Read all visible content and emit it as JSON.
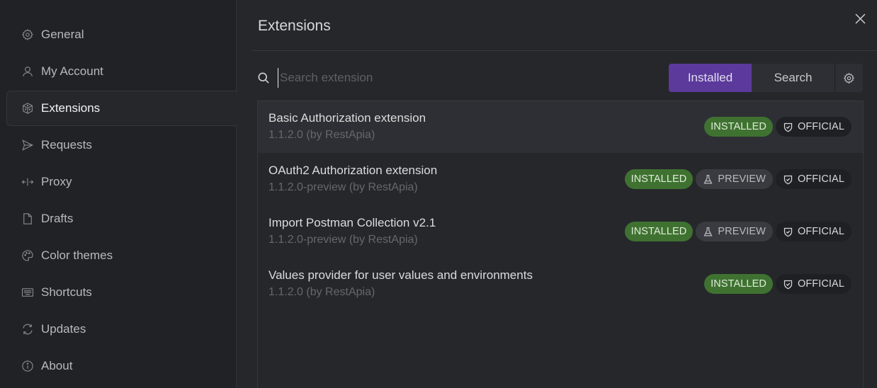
{
  "sidebar": {
    "items": [
      {
        "label": "General",
        "icon": "gear-icon",
        "active": false
      },
      {
        "label": "My Account",
        "icon": "user-icon",
        "active": false
      },
      {
        "label": "Extensions",
        "icon": "cube-icon",
        "active": true
      },
      {
        "label": "Requests",
        "icon": "send-icon",
        "active": false
      },
      {
        "label": "Proxy",
        "icon": "proxy-arrows-icon",
        "active": false
      },
      {
        "label": "Drafts",
        "icon": "file-icon",
        "active": false
      },
      {
        "label": "Color themes",
        "icon": "palette-icon",
        "active": false
      },
      {
        "label": "Shortcuts",
        "icon": "keyboard-icon",
        "active": false
      },
      {
        "label": "Updates",
        "icon": "refresh-icon",
        "active": false
      },
      {
        "label": "About",
        "icon": "info-icon",
        "active": false
      }
    ]
  },
  "header": {
    "title": "Extensions",
    "close_icon": "close-icon"
  },
  "search": {
    "value": "",
    "placeholder": "Search extension"
  },
  "filter": {
    "installed_label": "Installed",
    "search_label": "Search",
    "settings_icon": "gear-icon",
    "selected": "Installed"
  },
  "extensions": [
    {
      "name": "Basic Authorization extension",
      "version": "1.1.2.0 (by RestApia)",
      "badges": [
        "INSTALLED",
        "OFFICIAL"
      ],
      "selected": true
    },
    {
      "name": "OAuth2 Authorization extension",
      "version": "1.1.2.0-preview (by RestApia)",
      "badges": [
        "INSTALLED",
        "PREVIEW",
        "OFFICIAL"
      ],
      "selected": false
    },
    {
      "name": "Import Postman Collection v2.1",
      "version": "1.1.2.0-preview (by RestApia)",
      "badges": [
        "INSTALLED",
        "PREVIEW",
        "OFFICIAL"
      ],
      "selected": false
    },
    {
      "name": "Values provider for user values and environments",
      "version": "1.1.2.0 (by RestApia)",
      "badges": [
        "INSTALLED",
        "OFFICIAL"
      ],
      "selected": false
    }
  ],
  "colors": {
    "accent": "#5b3a9b",
    "installed_badge": "#3f7231",
    "preview_badge": "#3a3b40",
    "official_badge": "#1f2024"
  }
}
